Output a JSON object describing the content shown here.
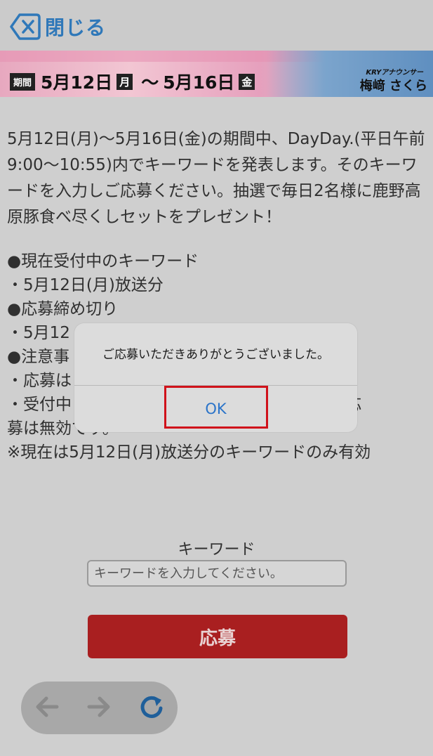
{
  "topbar": {
    "close_label": "閉じる"
  },
  "banner": {
    "period_tag": "期間",
    "start_date": "5月12日",
    "start_day": "月",
    "tilde": "〜",
    "end_date": "5月16日",
    "end_day": "金",
    "announcer_label": "KRYアナウンサー",
    "announcer_name": "梅﨑 さくら"
  },
  "description": "5月12日(月)〜5月16日(金)の期間中、DayDay.(平日午前9:00〜10:55)内でキーワードを発表します。そのキーワードを入力しご応募ください。抽選で毎日2名様に鹿野高原豚食べ尽くしセットをプレゼント！",
  "info_lines": [
    "●現在受付中のキーワード",
    "・5月12日(月)放送分",
    "●応募締め切り",
    "・5月12",
    "●注意事",
    "・応募は",
    "・受付中                                            しての応",
    "募は無効です。",
    "※現在は5月12日(月)放送分のキーワードのみ有効"
  ],
  "form": {
    "keyword_label": "キーワード",
    "keyword_placeholder": "キーワードを入力してください。",
    "keyword_value": "",
    "apply_label": "応募"
  },
  "dialog": {
    "message": "ご応募いただきありがとうございました。",
    "ok_label": "OK"
  },
  "colors": {
    "accent_blue": "#2f78b9",
    "apply_red": "#a91f20",
    "highlight_red": "#d0121b"
  }
}
